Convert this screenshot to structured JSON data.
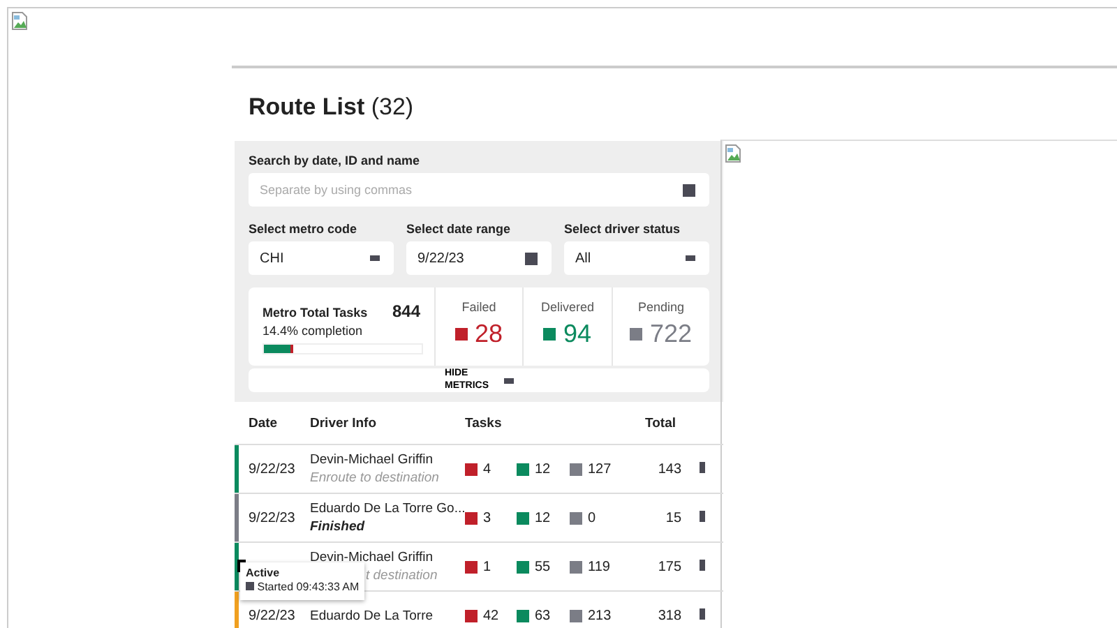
{
  "page": {
    "title": "Route List",
    "count": "(32)"
  },
  "search": {
    "label": "Search by date, ID and name",
    "placeholder": "Separate by using commas"
  },
  "filters": [
    {
      "label": "Select metro code",
      "value": "CHI",
      "kind": "select"
    },
    {
      "label": "Select date range",
      "value": "9/22/23",
      "kind": "date"
    },
    {
      "label": "Select driver status",
      "value": "All",
      "kind": "select"
    }
  ],
  "metrics": {
    "title": "Metro Total Tasks",
    "total": "844",
    "completion": "14.4% completion",
    "level": 0.19,
    "stats": [
      {
        "label": "Failed",
        "value": "28",
        "kind": "failed"
      },
      {
        "label": "Delivered",
        "value": "94",
        "kind": "delivered"
      },
      {
        "label": "Pending",
        "value": "722",
        "kind": "pending"
      }
    ],
    "toggle": "HIDE METRICS"
  },
  "table": {
    "columns": [
      "Date",
      "Driver Info",
      "Tasks",
      "Total"
    ],
    "rows": [
      {
        "date": "9/22/23",
        "driver": "Devin-Michael Griffin",
        "status": "Enroute to destination",
        "finished": false,
        "color": "#0b8a5e",
        "failed": "4",
        "delivered": "12",
        "pending": "127",
        "total": "143"
      },
      {
        "date": "9/22/23",
        "driver": "Eduardo De La Torre Go...",
        "status": "Finished",
        "finished": true,
        "color": "#7b7d86",
        "failed": "3",
        "delivered": "12",
        "pending": "0",
        "total": "15"
      },
      {
        "driver": "Devin-Michael Griffin",
        "status": "t destination",
        "finished": false,
        "color": "#0b8a5e",
        "failed": "1",
        "delivered": "55",
        "pending": "119",
        "total": "175",
        "tooltip": {
          "title": "Active",
          "text": "Started 09:43:33 AM"
        }
      },
      {
        "date": "9/22/23",
        "driver": "Eduardo De La Torre",
        "color": "#f0a020",
        "failed": "42",
        "delivered": "63",
        "pending": "213",
        "total": "318"
      }
    ]
  }
}
